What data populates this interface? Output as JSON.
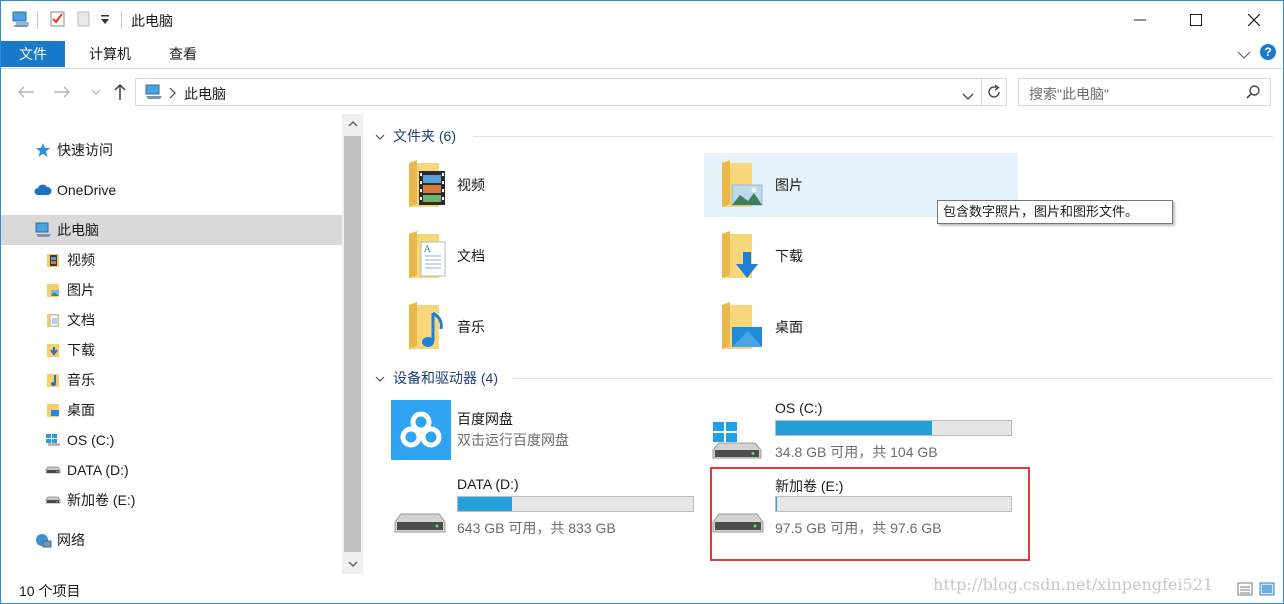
{
  "title_bar": {
    "title": "此电脑"
  },
  "ribbon": {
    "tabs": [
      "文件",
      "计算机",
      "查看"
    ],
    "active_tab": "文件"
  },
  "address": {
    "path": "此电脑",
    "search_placeholder": "搜索\"此电脑\""
  },
  "sidebar": {
    "quick_access": "快速访问",
    "onedrive": "OneDrive",
    "this_pc": "此电脑",
    "children": [
      "视频",
      "图片",
      "文档",
      "下载",
      "音乐",
      "桌面",
      "OS (C:)",
      "DATA (D:)",
      "新加卷 (E:)"
    ],
    "network": "网络"
  },
  "folders": {
    "header": "文件夹 (6)",
    "items": [
      "视频",
      "图片",
      "文档",
      "下载",
      "音乐",
      "桌面"
    ]
  },
  "tooltip": "包含数字照片，图片和图形文件。",
  "devices": {
    "header": "设备和驱动器 (4)",
    "baidu": {
      "name": "百度网盘",
      "subtitle": "双击运行百度网盘"
    },
    "drives": [
      {
        "name": "OS (C:)",
        "free_text": "34.8 GB 可用，共 104 GB",
        "used_fraction": 0.665
      },
      {
        "name": "DATA (D:)",
        "free_text": "643 GB 可用，共 833 GB",
        "used_fraction": 0.228
      },
      {
        "name": "新加卷 (E:)",
        "free_text": "97.5 GB 可用，共 97.6 GB",
        "used_fraction": 0.001
      }
    ]
  },
  "status": {
    "count": "10 个项目"
  },
  "watermark": "http://blog.csdn.net/xinpengfei521",
  "colors": {
    "accent": "#1979ca",
    "drive_bar": "#26a0da",
    "highlight_box": "#e53935",
    "hover": "#e5f3fb"
  }
}
